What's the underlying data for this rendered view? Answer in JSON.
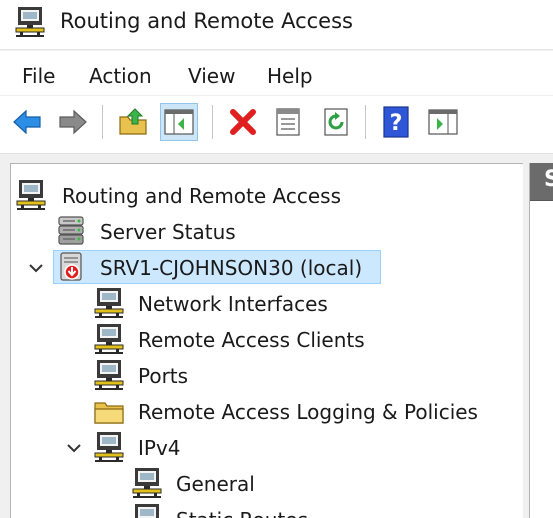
{
  "window": {
    "title": "Routing and Remote Access"
  },
  "menu": {
    "file": "File",
    "action": "Action",
    "view": "View",
    "help": "Help"
  },
  "toolbar": {
    "buttons": [
      {
        "icon": "back-arrow-icon"
      },
      {
        "icon": "forward-arrow-icon"
      },
      {
        "icon": "up-one-level-icon"
      },
      {
        "icon": "show-hide-console-tree-icon",
        "active": true
      },
      {
        "icon": "delete-icon"
      },
      {
        "icon": "properties-icon"
      },
      {
        "icon": "refresh-icon"
      },
      {
        "icon": "help-icon"
      },
      {
        "icon": "show-action-pane-icon"
      }
    ]
  },
  "tree": {
    "root": "Routing and Remote Access",
    "server_status": "Server Status",
    "server": "SRV1-CJOHNSON30 (local)",
    "network_interfaces": "Network Interfaces",
    "remote_access_clients": "Remote Access Clients",
    "ports": "Ports",
    "logging": "Remote Access Logging & Policies",
    "ipv4": "IPv4",
    "general": "General",
    "static_routes": "Static Routes"
  },
  "right_pane": {
    "header_letter": "S"
  },
  "colors": {
    "selection": "#cce8ff",
    "selection_border": "#99d1ff",
    "accent": "#1e7bd7"
  }
}
